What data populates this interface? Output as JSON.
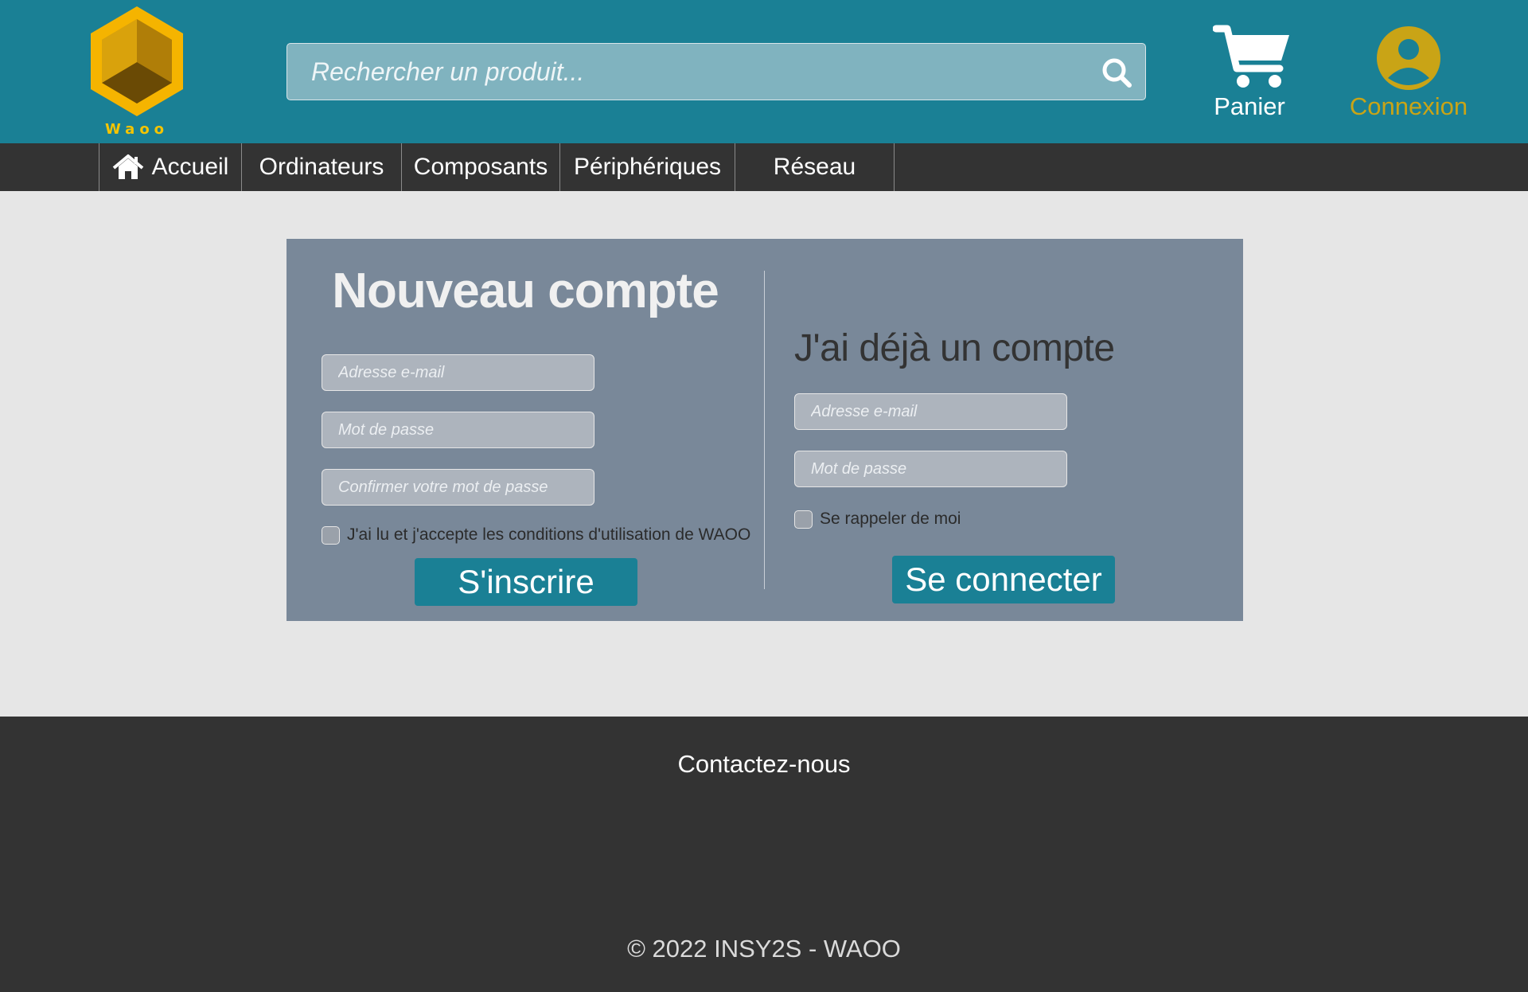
{
  "brand": {
    "logo_text": "Waoo"
  },
  "search": {
    "placeholder": "Rechercher un produit..."
  },
  "header": {
    "cart_label": "Panier",
    "account_label": "Connexion"
  },
  "nav": {
    "items": [
      "Accueil",
      "Ordinateurs",
      "Composants",
      "Périphériques",
      "Réseau"
    ]
  },
  "register": {
    "title": "Nouveau compte",
    "email_placeholder": "Adresse e-mail",
    "password_placeholder": "Mot de passe",
    "confirm_placeholder": "Confirmer votre mot de passe",
    "terms_label": "J'ai lu et j'accepte les conditions d'utilisation de WAOO",
    "submit_label": "S'inscrire"
  },
  "login": {
    "title": "J'ai déjà un compte",
    "email_placeholder": "Adresse e-mail",
    "password_placeholder": "Mot de passe",
    "remember_label": "Se rappeler de moi",
    "submit_label": "Se connecter"
  },
  "footer": {
    "contact": "Contactez-nous",
    "copyright": "© 2022 INSY2S - WAOO"
  },
  "colors": {
    "header_bg": "#1a8095",
    "nav_bg": "#333333",
    "panel_bg": "#798899",
    "accent_gold": "#c9a416",
    "page_bg": "#e6e6e6"
  },
  "icons": [
    "logo-hexagon-icon",
    "search-icon",
    "cart-icon",
    "user-icon",
    "home-icon"
  ]
}
